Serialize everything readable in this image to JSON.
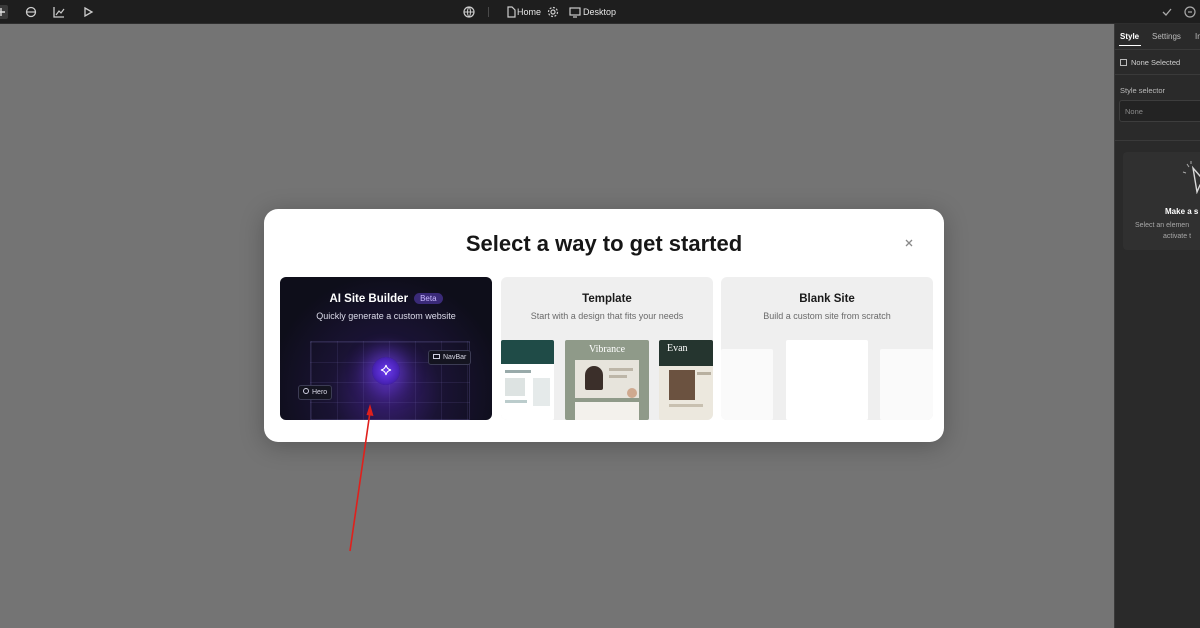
{
  "topbar": {
    "page_name": "Home",
    "device_name": "Desktop"
  },
  "modal": {
    "title": "Select a way to get started",
    "cards": [
      {
        "title": "AI Site Builder",
        "badge": "Beta",
        "subtitle": "Quickly generate a custom website"
      },
      {
        "title": "Template",
        "subtitle": "Start with a design that fits your needs"
      },
      {
        "title": "Blank Site",
        "subtitle": "Build a custom site from scratch"
      }
    ],
    "ai_preview": {
      "tag_navbar": "NavBar",
      "tag_hero": "Hero"
    },
    "template_preview": {
      "thumb2_title": "Vibrance",
      "thumb3_title": "Evan"
    }
  },
  "right_panel": {
    "tabs": [
      "Style",
      "Settings",
      "In"
    ],
    "none_selected": "None Selected",
    "style_selector_label": "Style selector",
    "style_selector_value": "None",
    "empty_title": "Make a s",
    "empty_line1": "Select an elemen",
    "empty_line2": "activate t"
  },
  "colors": {
    "accent_purple": "#6d3cf0",
    "annotation_arrow": "#e0201c",
    "backdrop": "#747474"
  }
}
